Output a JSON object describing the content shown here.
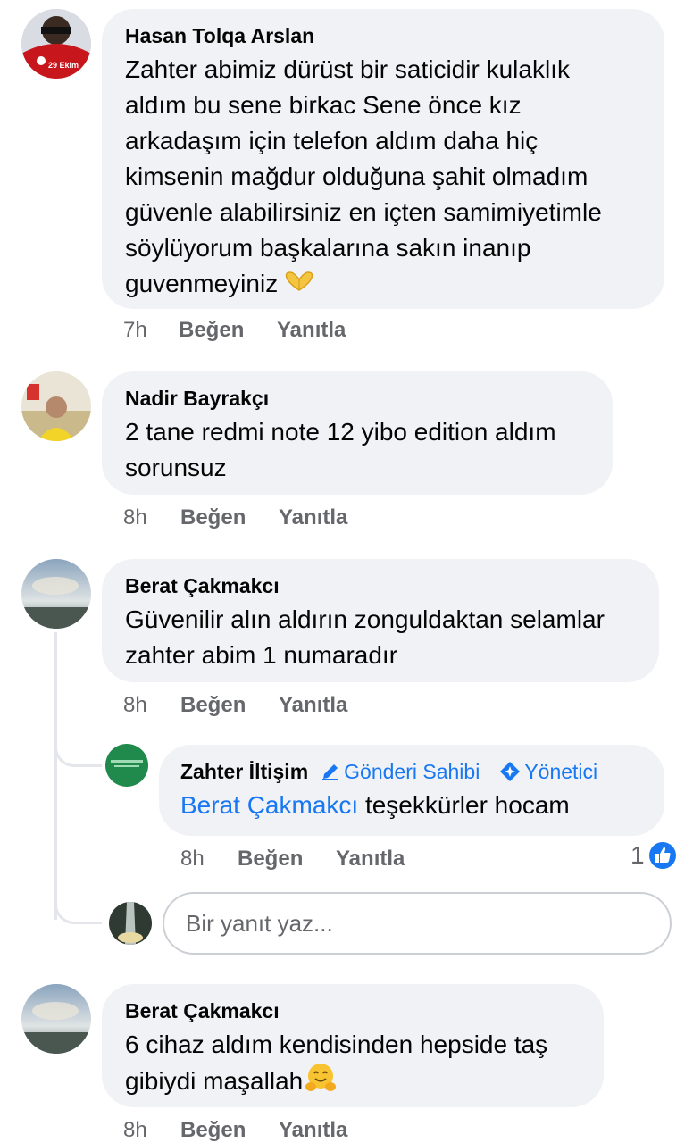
{
  "comments": [
    {
      "author": "Hasan Tolqa Arslan",
      "lines": [
        "Zahter abimiz dürüst bir saticidir kulaklık",
        "aldım bu sene birkac Sene önce kız",
        "arkadaşım için telefon aldım daha hiç",
        "kimsenin mağdur olduğuna şahit olmadım",
        "güvenle alabilirsiniz en içten samimiyetimle",
        "söylüyorum başkalarına sakın inanıp",
        "guvenmeyiniz"
      ],
      "emoji": "heart-hands-emoji",
      "avatar_badge": "29 Ekim",
      "time": "7h",
      "like_label": "Beğen",
      "reply_label": "Yanıtla"
    },
    {
      "author": "Nadir Bayrakçı",
      "lines": [
        "2 tane redmi note 12 yibo edition aldım",
        "sorunsuz"
      ],
      "time": "8h",
      "like_label": "Beğen",
      "reply_label": "Yanıtla"
    },
    {
      "author": "Berat Çakmakcı",
      "lines": [
        "Güvenilir alın aldırın zonguldaktan selamlar",
        "zahter abim 1 numaradır"
      ],
      "time": "8h",
      "like_label": "Beğen",
      "reply_label": "Yanıtla",
      "reply": {
        "author": "Zahter İltişim",
        "badge_author": "Gönderi Sahibi",
        "badge_admin": "Yönetici",
        "mention": "Berat Çakmakcı",
        "text": "teşekkürler hocam",
        "time": "8h",
        "like_label": "Beğen",
        "reply_label": "Yanıtla",
        "reaction_count": "1"
      },
      "reply_input_placeholder": "Bir yanıt yaz..."
    },
    {
      "author": "Berat Çakmakcı",
      "lines": [
        "6 cihaz aldım kendisinden hepside taş",
        "gibiydi maşallah"
      ],
      "emoji": "hugging-face-emoji",
      "time": "8h",
      "like_label": "Beğen",
      "reply_label": "Yanıtla"
    }
  ],
  "colors": {
    "bubble": "#f0f2f5",
    "meta": "#65676b",
    "accent": "#1877f2"
  }
}
